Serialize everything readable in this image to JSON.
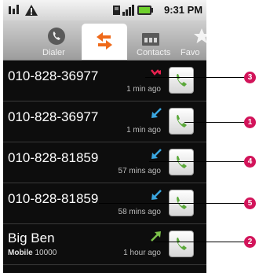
{
  "status_bar": {
    "time": "9:31 PM"
  },
  "tabs": [
    {
      "label": "Dialer"
    },
    {
      "label": ""
    },
    {
      "label": "Contacts"
    },
    {
      "label": "Favo"
    }
  ],
  "calls": [
    {
      "number": "010-828-36977",
      "type": "missed",
      "time_ago": "1 min ago",
      "callout": "3"
    },
    {
      "number": "010-828-36977",
      "type": "incoming",
      "time_ago": "1 min ago",
      "callout": "1"
    },
    {
      "number": "010-828-81859",
      "type": "incoming",
      "time_ago": "57 mins ago",
      "callout": "4"
    },
    {
      "number": "010-828-81859",
      "type": "incoming",
      "time_ago": "58 mins ago",
      "callout": "5"
    },
    {
      "name": "Big Ben",
      "label": "Mobile",
      "number": "10000",
      "type": "outgoing",
      "time_ago": "1 hour ago",
      "callout": "2"
    }
  ],
  "colors": {
    "missed": "#e8214f",
    "incoming": "#3aa6e0",
    "outgoing": "#7cc24a",
    "callout": "#d2145a",
    "phone_green": "#5aa83a"
  }
}
